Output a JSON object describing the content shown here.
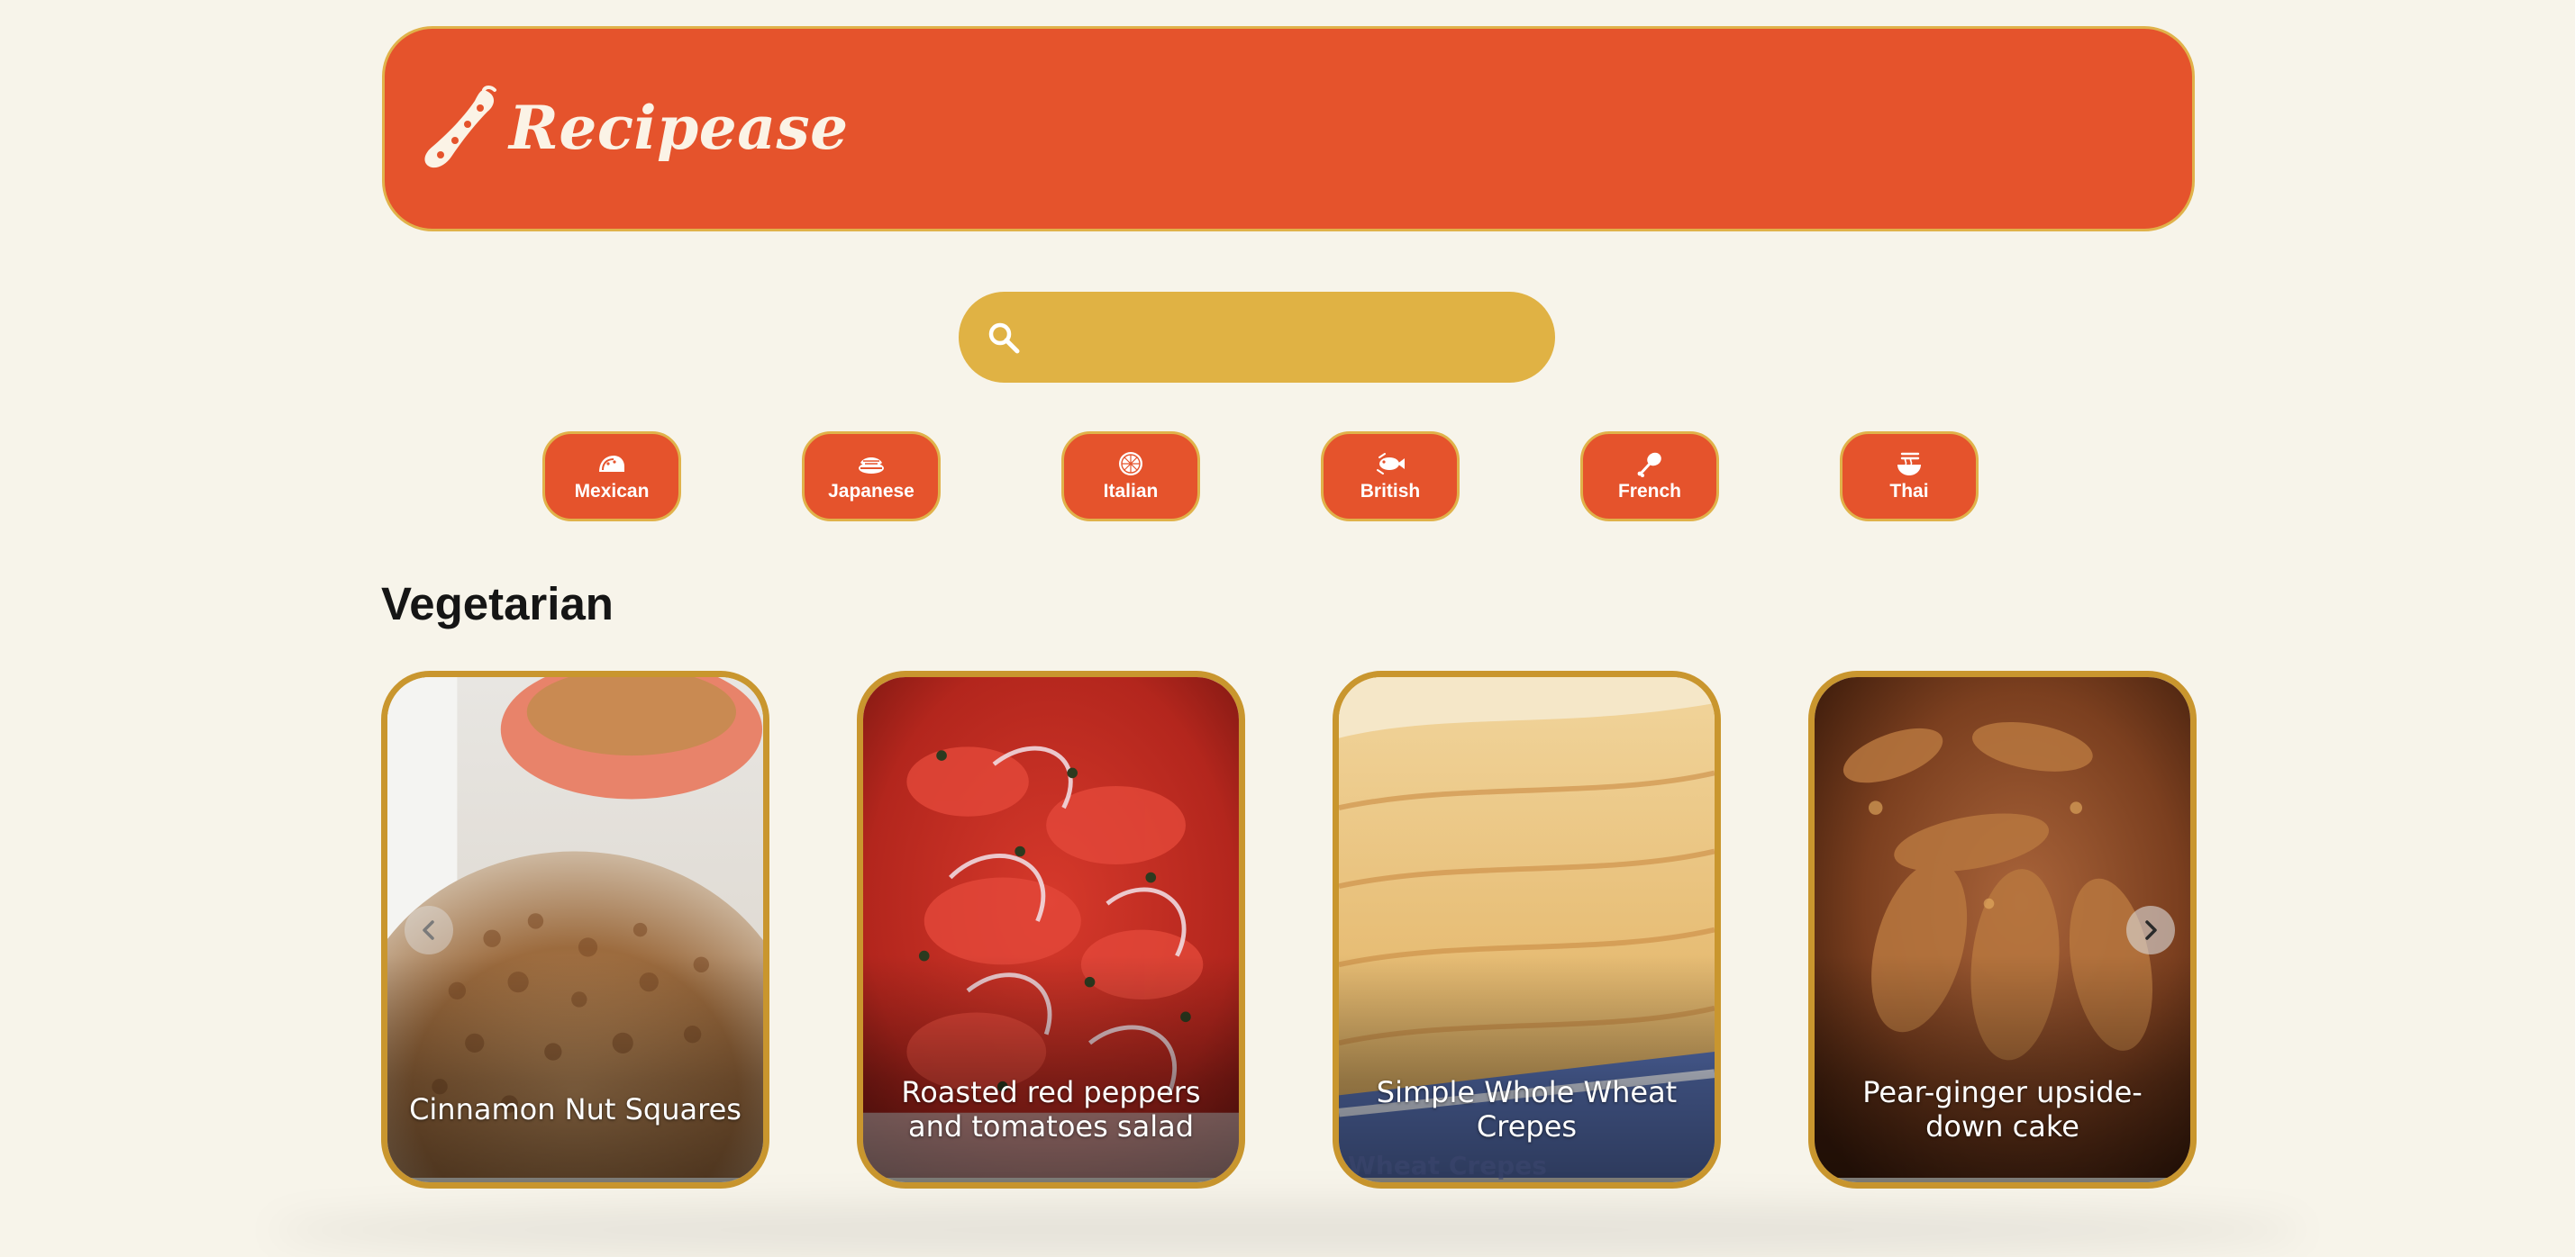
{
  "brand": {
    "name": "Recipease",
    "color": "#e5532c",
    "accent": "#e0b244",
    "background": "#f7f4ea"
  },
  "search": {
    "placeholder": "",
    "value": "",
    "icon": "search-icon"
  },
  "cuisines": [
    {
      "label": "Mexican",
      "icon": "taco-icon"
    },
    {
      "label": "Japanese",
      "icon": "sushi-icon"
    },
    {
      "label": "Italian",
      "icon": "pizza-icon"
    },
    {
      "label": "British",
      "icon": "fish-icon"
    },
    {
      "label": "French",
      "icon": "chicken-leg-icon"
    },
    {
      "label": "Thai",
      "icon": "noodle-bowl-icon"
    }
  ],
  "section": {
    "title": "Vegetarian"
  },
  "recipes": [
    {
      "title": "Cinnamon Nut Squares"
    },
    {
      "title": "Roasted red peppers and tomatoes salad"
    },
    {
      "title": "Simple Whole Wheat Crepes",
      "watermark": "Wheat Crepes"
    },
    {
      "title": "Pear-ginger upside-down cake"
    }
  ],
  "carousel": {
    "prev_icon": "chevron-left-icon",
    "next_icon": "chevron-right-icon"
  }
}
